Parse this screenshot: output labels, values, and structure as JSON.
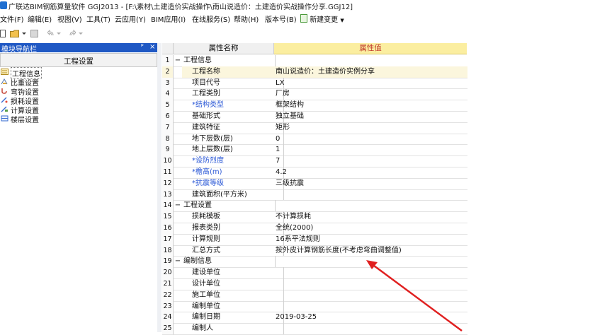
{
  "window": {
    "title": "广联达BIM钢筋算量软件 GGJ2013 - [F:\\素材\\土建造价实战操作\\南山说造价：土建造价实战操作分享.GGJ12]"
  },
  "menu": {
    "items": [
      "文件(F)",
      "编辑(E)",
      "视图(V)",
      "工具(T)",
      "云应用(Y)",
      "BIM应用(I)",
      "在线服务(S)",
      "帮助(H)",
      "版本号(B)",
      "新建变更"
    ]
  },
  "nav_panel": {
    "title": "模块导航栏",
    "pin": "ᵖ",
    "close": "×",
    "tab_label": "工程设置",
    "items": [
      {
        "label": "工程信息",
        "icon": "info-icon"
      },
      {
        "label": "比重设置",
        "icon": "weight-icon"
      },
      {
        "label": "弯钩设置",
        "icon": "hook-icon"
      },
      {
        "label": "损耗设置",
        "icon": "loss-icon"
      },
      {
        "label": "计算设置",
        "icon": "calc-icon"
      },
      {
        "label": "楼层设置",
        "icon": "floor-icon"
      }
    ]
  },
  "grid": {
    "header": {
      "name": "属性名称",
      "value": "属性值"
    },
    "rows": [
      {
        "num": "1",
        "tree": "−",
        "name": "工程信息",
        "value": "",
        "kind": "group"
      },
      {
        "num": "2",
        "tree": "",
        "name": "工程名称",
        "value": "南山说造价：土建造价实例分享",
        "kind": "prop",
        "selected": true
      },
      {
        "num": "3",
        "tree": "",
        "name": "项目代号",
        "value": "LX",
        "kind": "prop"
      },
      {
        "num": "4",
        "tree": "",
        "name": "工程类别",
        "value": "厂房",
        "kind": "prop"
      },
      {
        "num": "5",
        "tree": "",
        "name": "*结构类型",
        "value": "框架结构",
        "kind": "prop",
        "required": true
      },
      {
        "num": "6",
        "tree": "",
        "name": "基础形式",
        "value": "独立基础",
        "kind": "prop"
      },
      {
        "num": "7",
        "tree": "",
        "name": "建筑特征",
        "value": "矩形",
        "kind": "prop"
      },
      {
        "num": "8",
        "tree": "",
        "name": "地下层数(层)",
        "value": "0",
        "kind": "prop"
      },
      {
        "num": "9",
        "tree": "",
        "name": "地上层数(层)",
        "value": "1",
        "kind": "prop"
      },
      {
        "num": "10",
        "tree": "",
        "name": "*设防烈度",
        "value": "7",
        "kind": "prop",
        "required": true
      },
      {
        "num": "11",
        "tree": "",
        "name": "*檐高(m)",
        "value": "4.2",
        "kind": "prop",
        "required": true
      },
      {
        "num": "12",
        "tree": "",
        "name": "*抗震等级",
        "value": "三级抗震",
        "kind": "prop",
        "required": true
      },
      {
        "num": "13",
        "tree": "",
        "name": "建筑面积(平方米)",
        "value": "",
        "kind": "prop"
      },
      {
        "num": "14",
        "tree": "−",
        "name": "工程设置",
        "value": "",
        "kind": "group"
      },
      {
        "num": "15",
        "tree": "",
        "name": "损耗模板",
        "value": "不计算损耗",
        "kind": "prop"
      },
      {
        "num": "16",
        "tree": "",
        "name": "报表类别",
        "value": "全统(2000)",
        "kind": "prop"
      },
      {
        "num": "17",
        "tree": "",
        "name": "计算规则",
        "value": "16系平法规则",
        "kind": "prop"
      },
      {
        "num": "18",
        "tree": "",
        "name": "汇总方式",
        "value": "按外皮计算钢筋长度(不考虑弯曲调整值)",
        "kind": "prop"
      },
      {
        "num": "19",
        "tree": "−",
        "name": "编制信息",
        "value": "",
        "kind": "group"
      },
      {
        "num": "20",
        "tree": "",
        "name": "建设单位",
        "value": "",
        "kind": "prop"
      },
      {
        "num": "21",
        "tree": "",
        "name": "设计单位",
        "value": "",
        "kind": "prop"
      },
      {
        "num": "22",
        "tree": "",
        "name": "施工单位",
        "value": "",
        "kind": "prop"
      },
      {
        "num": "23",
        "tree": "",
        "name": "编制单位",
        "value": "",
        "kind": "prop"
      },
      {
        "num": "24",
        "tree": "",
        "name": "编制日期",
        "value": "2019-03-25",
        "kind": "prop"
      },
      {
        "num": "25",
        "tree": "",
        "name": "编制人",
        "value": "",
        "kind": "prop"
      }
    ]
  },
  "colors": {
    "accent": "#1f58c4",
    "annotation_arrow": "#e02020",
    "value_header_bg": "#fbeea0",
    "required_text": "#2b58d6"
  }
}
